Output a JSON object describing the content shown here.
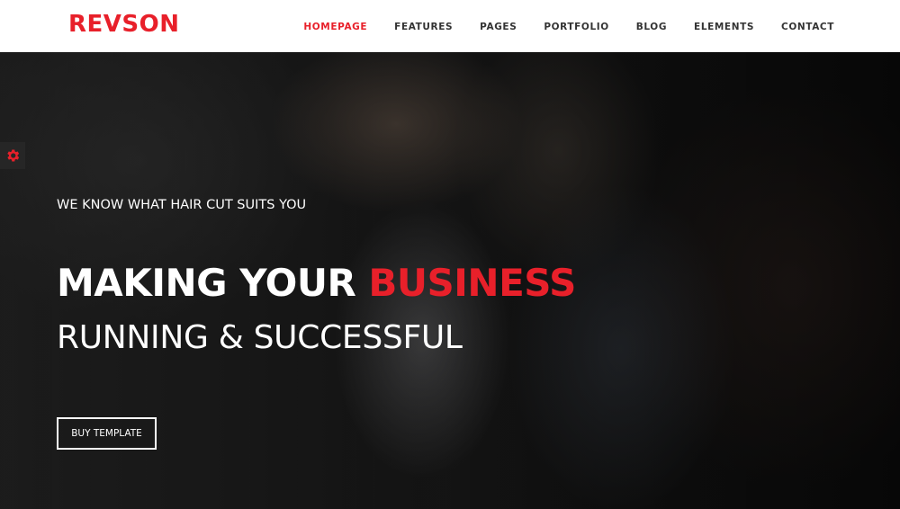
{
  "brand": {
    "logo_text": "REVSON",
    "accent_color": "#e8202a"
  },
  "nav": {
    "items": [
      {
        "label": "HOMEPAGE",
        "active": true
      },
      {
        "label": "FEATURES",
        "active": false
      },
      {
        "label": "PAGES",
        "active": false
      },
      {
        "label": "PORTFOLIO",
        "active": false
      },
      {
        "label": "BLOG",
        "active": false
      },
      {
        "label": "ELEMENTS",
        "active": false
      },
      {
        "label": "CONTACT",
        "active": false
      }
    ]
  },
  "settings": {
    "icon": "gear-icon"
  },
  "hero": {
    "subtitle": "WE KNOW WHAT HAIR CUT SUITS YOU",
    "title_part1": "MAKING YOUR",
    "title_accent": "BUSINESS",
    "title_line2": "RUNNING & SUCCESSFUL",
    "cta_label": "BUY TEMPLATE"
  }
}
